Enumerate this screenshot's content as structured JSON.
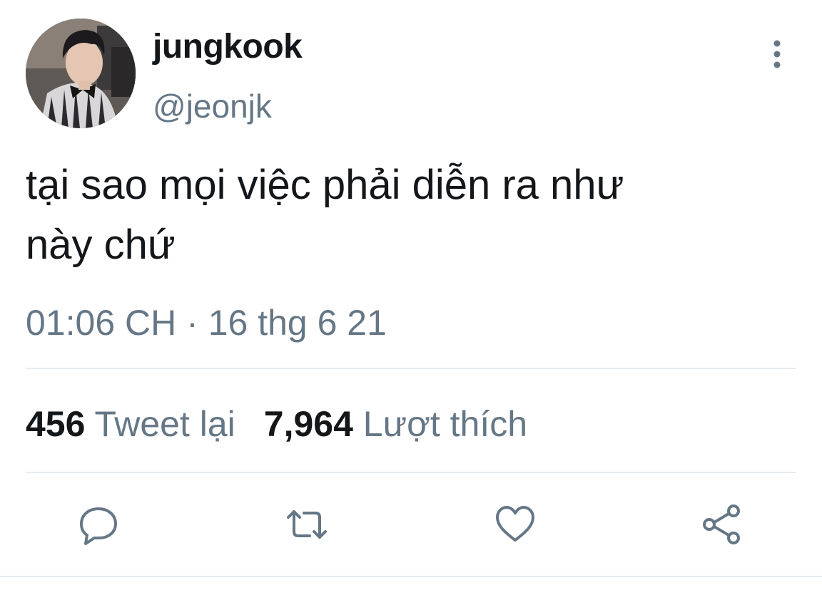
{
  "author": {
    "display_name": "jungkook",
    "handle": "@jeonjk"
  },
  "tweet": {
    "text_line1": "tại sao mọi việc phải diễn ra như",
    "text_line2": "này chứ",
    "time": "01:06 CH",
    "separator": "·",
    "date": "16 thg 6 21"
  },
  "stats": {
    "retweets_count": "456",
    "retweets_label": "Tweet lại",
    "likes_count": "7,964",
    "likes_label": "Lượt thích"
  },
  "icons": {
    "more": "vertical-ellipsis-icon",
    "reply": "speech-bubble-icon",
    "retweet": "retweet-arrows-icon",
    "like": "heart-icon",
    "share": "share-nodes-icon"
  },
  "colors": {
    "text": "#14171a",
    "secondary": "#657786",
    "divider": "#e6ecf0"
  }
}
